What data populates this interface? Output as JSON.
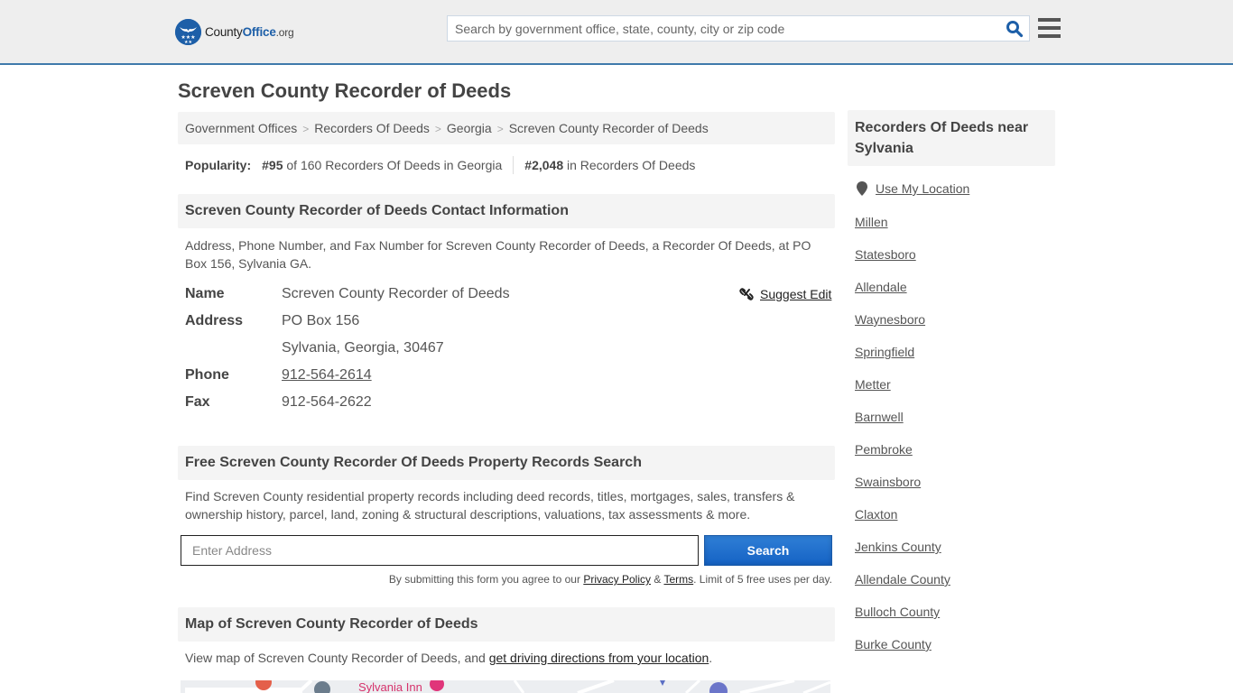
{
  "header": {
    "logo": {
      "county": "County",
      "office": "Office",
      "org": ".org"
    },
    "search_placeholder": "Search by government office, state, county, city or zip code"
  },
  "page_title": "Screven County Recorder of Deeds",
  "breadcrumb": [
    {
      "label": "Government Offices"
    },
    {
      "label": "Recorders Of Deeds"
    },
    {
      "label": "Georgia"
    },
    {
      "label": "Screven County Recorder of Deeds"
    }
  ],
  "popularity": {
    "label": "Popularity:",
    "state_rank": "#95",
    "state_text": "of 160 Recorders Of Deeds in Georgia",
    "national_rank": "#2,048",
    "national_text": "in Recorders Of Deeds"
  },
  "contact": {
    "heading": "Screven County Recorder of Deeds Contact Information",
    "description": "Address, Phone Number, and Fax Number for Screven County Recorder of Deeds, a Recorder Of Deeds, at PO Box 156, Sylvania GA.",
    "suggest_edit": "Suggest Edit",
    "fields": {
      "name_label": "Name",
      "name_value": "Screven County Recorder of Deeds",
      "address_label": "Address",
      "address_line1": "PO Box 156",
      "address_line2": "Sylvania, Georgia, 30467",
      "phone_label": "Phone",
      "phone_value": "912-564-2614",
      "fax_label": "Fax",
      "fax_value": "912-564-2622"
    }
  },
  "property_search": {
    "heading": "Free Screven County Recorder Of Deeds Property Records Search",
    "description": "Find Screven County residential property records including deed records, titles, mortgages, sales, transfers & ownership history, parcel, land, zoning & structural descriptions, valuations, tax assessments & more.",
    "input_placeholder": "Enter Address",
    "button_label": "Search",
    "disclaimer_prefix": "By submitting this form you agree to our ",
    "privacy_link": "Privacy Policy",
    "amp": " & ",
    "terms_link": "Terms",
    "disclaimer_suffix": ". Limit of 5 free uses per day."
  },
  "map_section": {
    "heading": "Map of Screven County Recorder of Deeds",
    "description_prefix": "View map of Screven County Recorder of Deeds, and ",
    "directions_link": "get driving directions from your location",
    "description_suffix": ".",
    "map_label": "Sylvania Inn"
  },
  "sidebar": {
    "heading": "Recorders Of Deeds near Sylvania",
    "use_location": "Use My Location",
    "links": [
      "Millen",
      "Statesboro",
      "Allendale",
      "Waynesboro",
      "Springfield",
      "Metter",
      "Barnwell",
      "Pembroke",
      "Swainsboro",
      "Claxton",
      "Jenkins County",
      "Allendale County",
      "Bulloch County",
      "Burke County"
    ]
  },
  "colors": {
    "brand_blue": "#1d5fa8",
    "header_border": "#3f7aab",
    "button_blue": "#1562c4",
    "map_poi_pink": "#e0357a"
  }
}
